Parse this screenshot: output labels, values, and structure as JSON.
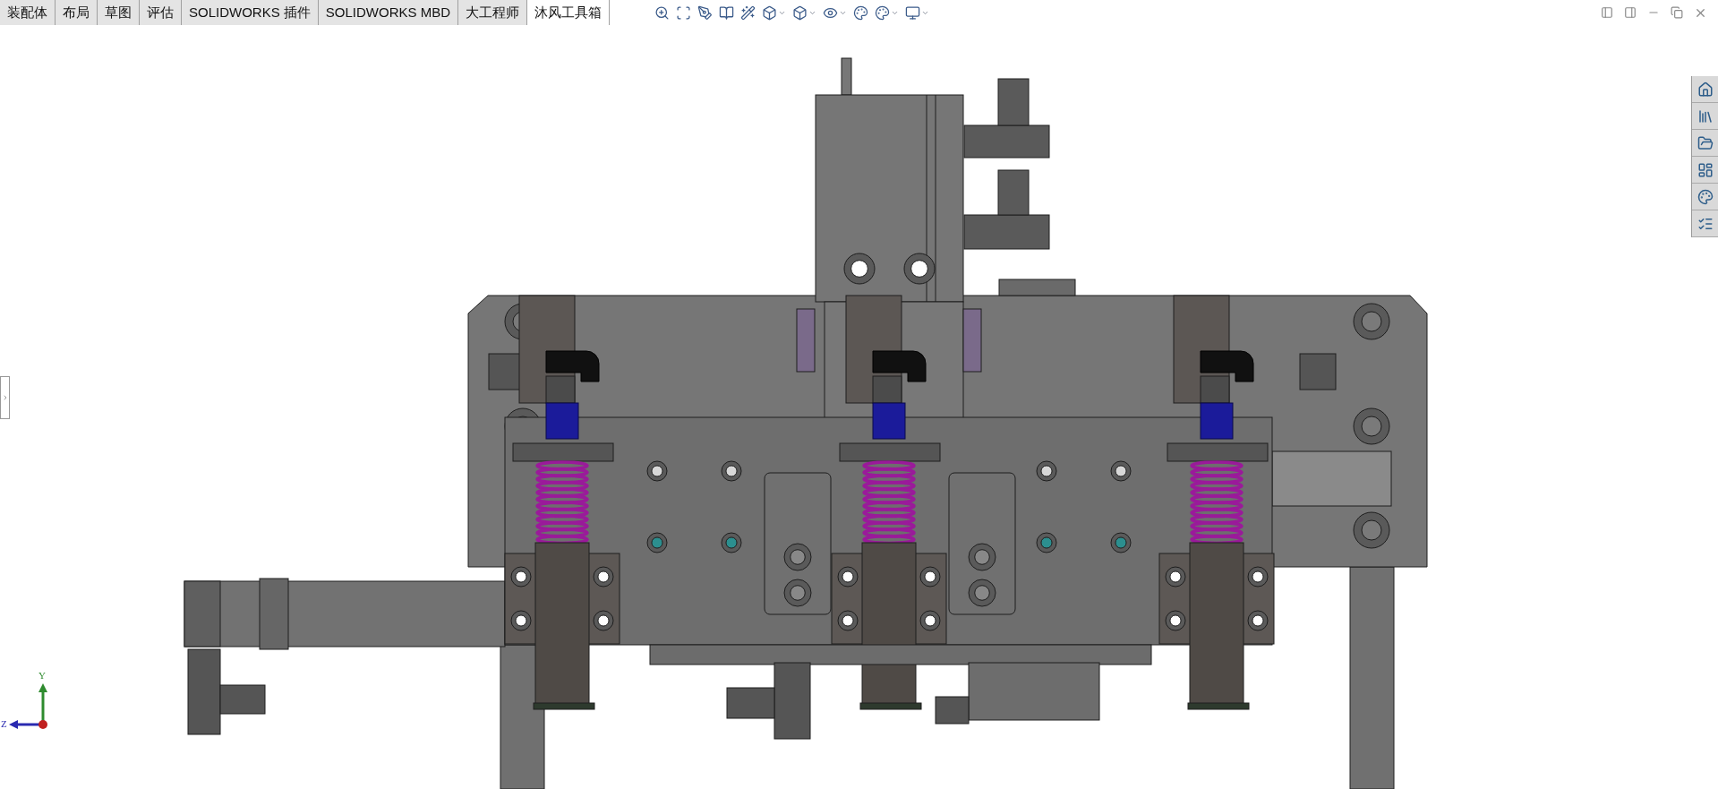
{
  "tabs": [
    {
      "label": "装配体",
      "selected": false
    },
    {
      "label": "布局",
      "selected": false
    },
    {
      "label": "草图",
      "selected": false
    },
    {
      "label": "评估",
      "selected": false
    },
    {
      "label": "SOLIDWORKS 插件",
      "selected": false
    },
    {
      "label": "SOLIDWORKS MBD",
      "selected": false
    },
    {
      "label": "大工程师",
      "selected": false
    },
    {
      "label": "沐风工具箱",
      "selected": true
    }
  ],
  "triad": {
    "y_label": "Y",
    "z_label": "Z"
  }
}
